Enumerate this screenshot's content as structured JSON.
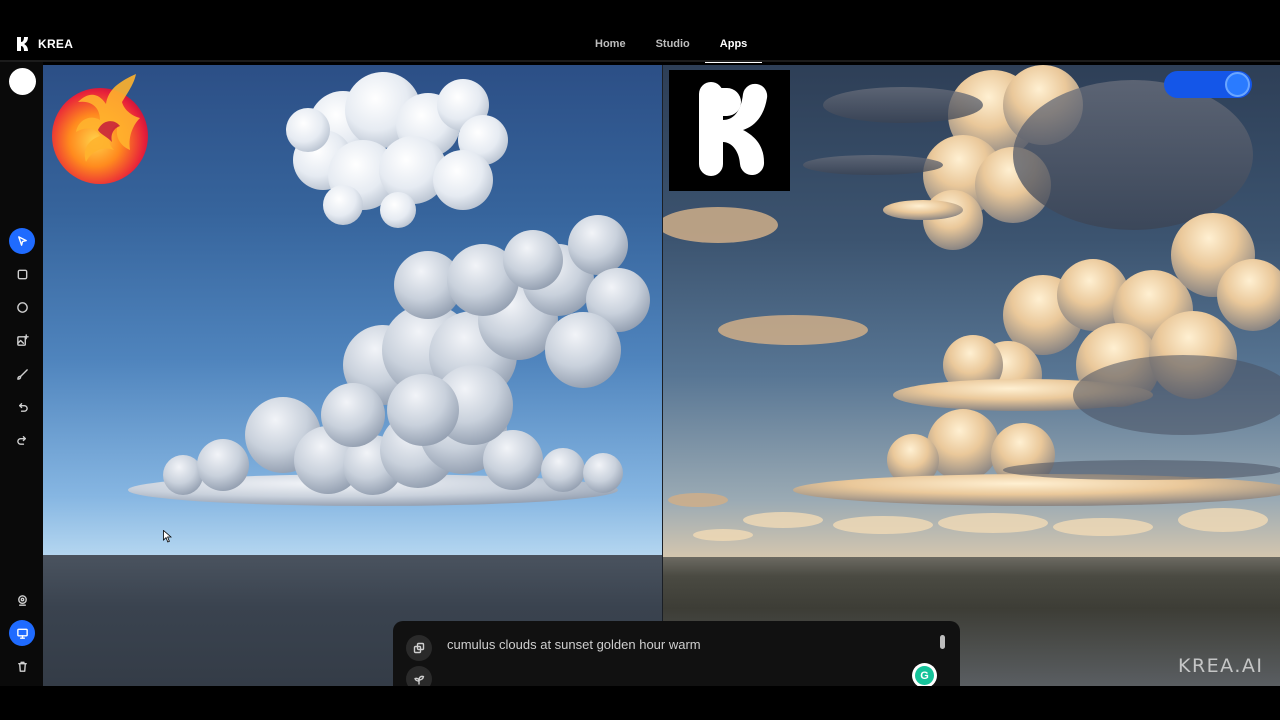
{
  "app": {
    "name": "KREA",
    "logo_icon": "krea-logo-icon"
  },
  "nav": {
    "tabs": [
      {
        "label": "Home",
        "active": false
      },
      {
        "label": "Studio",
        "active": false
      },
      {
        "label": "Apps",
        "active": true
      }
    ]
  },
  "toolbar": {
    "tools": [
      {
        "name": "select-tool",
        "icon": "cursor-arrow-icon",
        "active": true
      },
      {
        "name": "rectangle-tool",
        "icon": "square-icon",
        "active": false
      },
      {
        "name": "ellipse-tool",
        "icon": "circle-icon",
        "active": false
      },
      {
        "name": "image-tool",
        "icon": "image-add-icon",
        "active": false
      },
      {
        "name": "brush-tool",
        "icon": "brush-icon",
        "active": false
      },
      {
        "name": "undo",
        "icon": "undo-icon",
        "active": false
      },
      {
        "name": "redo",
        "icon": "redo-icon",
        "active": false
      }
    ],
    "bottom_tools": [
      {
        "name": "webcam-button",
        "icon": "webcam-icon",
        "active": false
      },
      {
        "name": "screen-share-button",
        "icon": "monitor-icon",
        "active": true
      },
      {
        "name": "delete-button",
        "icon": "trash-icon",
        "active": false
      }
    ]
  },
  "canvas": {
    "left_subject": "cumulus clouds 3D render",
    "right_subject": "generated sunset clouds"
  },
  "prompt": {
    "text": "cumulus clouds at sunset golden hour warm"
  },
  "watermark": "KREA.AI",
  "colors": {
    "accent": "#1f6bff",
    "toggle": "#1456e8"
  }
}
